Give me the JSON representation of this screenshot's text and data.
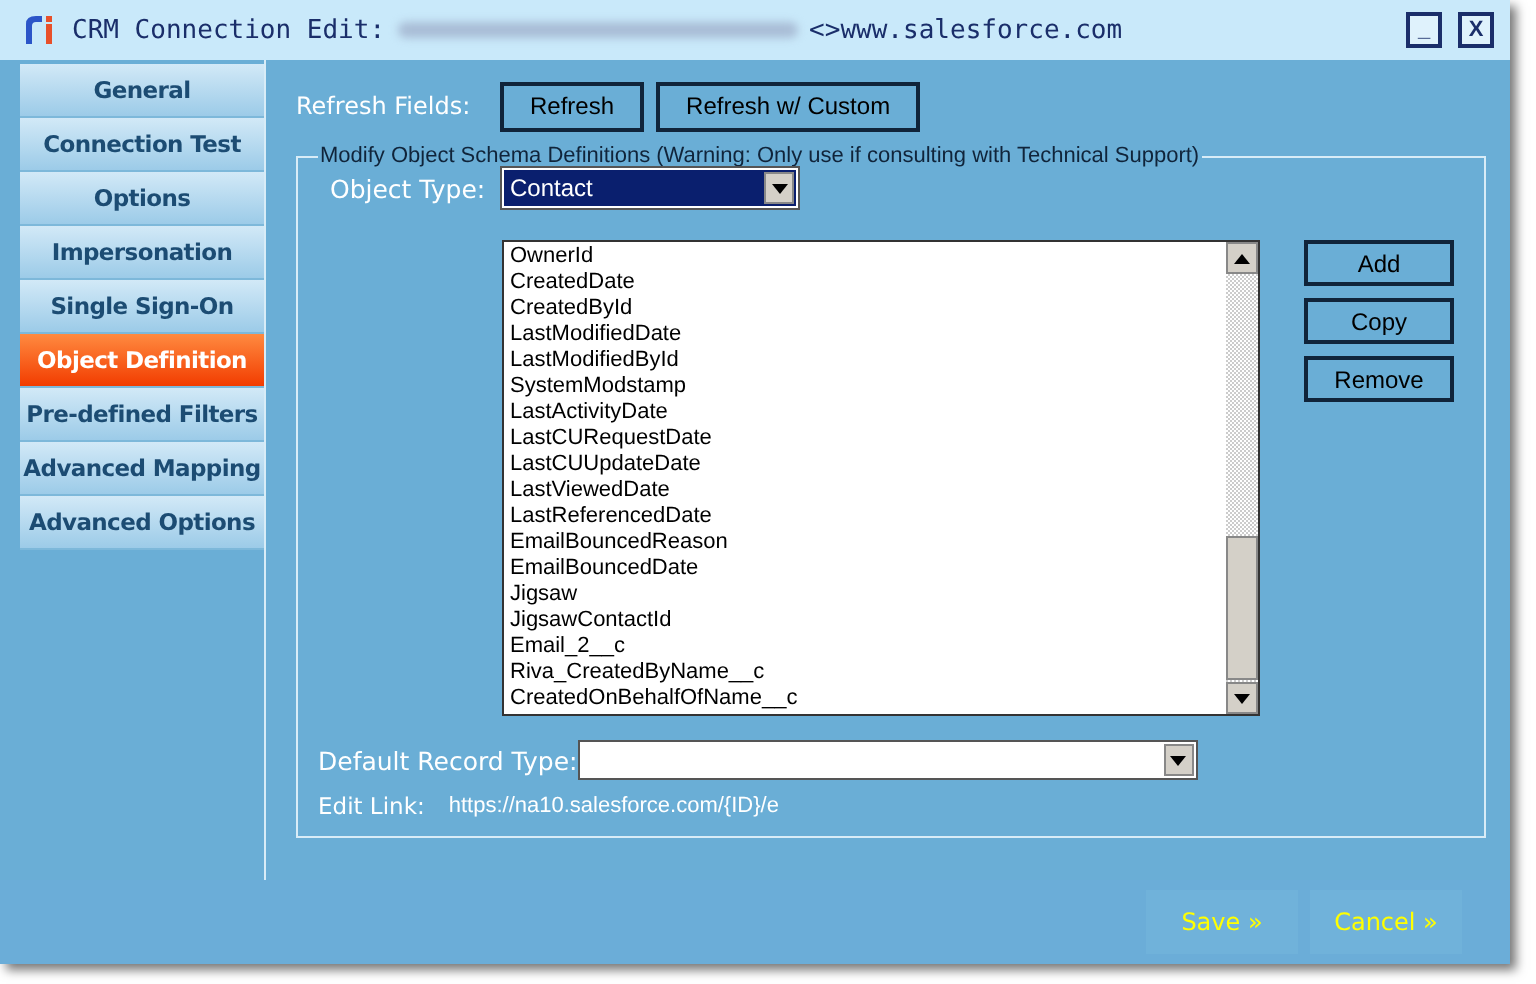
{
  "window": {
    "title": "CRM Connection Edit:",
    "title_suffix": "<>www.salesforce.com",
    "controls": [
      "_",
      "X"
    ]
  },
  "sidebar": {
    "items": [
      {
        "label": "General",
        "selected": false
      },
      {
        "label": "Connection Test",
        "selected": false
      },
      {
        "label": "Options",
        "selected": false
      },
      {
        "label": "Impersonation",
        "selected": false
      },
      {
        "label": "Single Sign-On",
        "selected": false
      },
      {
        "label": "Object Definition",
        "selected": true
      },
      {
        "label": "Pre-defined Filters",
        "selected": false
      },
      {
        "label": "Advanced Mapping",
        "selected": false
      },
      {
        "label": "Advanced Options",
        "selected": false
      }
    ]
  },
  "refresh": {
    "label": "Refresh Fields:",
    "buttons": [
      "Refresh",
      "Refresh w/ Custom"
    ]
  },
  "schema": {
    "legend": "Modify Object Schema Definitions (Warning: Only use if consulting with Technical Support)",
    "object_type": {
      "label": "Object Type:",
      "value": "Contact"
    },
    "fields": [
      "OwnerId",
      "CreatedDate",
      "CreatedById",
      "LastModifiedDate",
      "LastModifiedById",
      "SystemModstamp",
      "LastActivityDate",
      "LastCURequestDate",
      "LastCUUpdateDate",
      "LastViewedDate",
      "LastReferencedDate",
      "EmailBouncedReason",
      "EmailBouncedDate",
      "Jigsaw",
      "JigsawContactId",
      "Email_2__c",
      "Riva_CreatedByName__c",
      "CreatedOnBehalfOfName__c"
    ],
    "buttons": [
      "Add",
      "Copy",
      "Remove"
    ],
    "default_record_type": {
      "label": "Default Record Type:"
    },
    "edit_link": {
      "label": "Edit Link:",
      "value": "https://na10.salesforce.com/{ID}/e"
    }
  },
  "footer": {
    "buttons": [
      "Save »",
      "Cancel »"
    ]
  }
}
